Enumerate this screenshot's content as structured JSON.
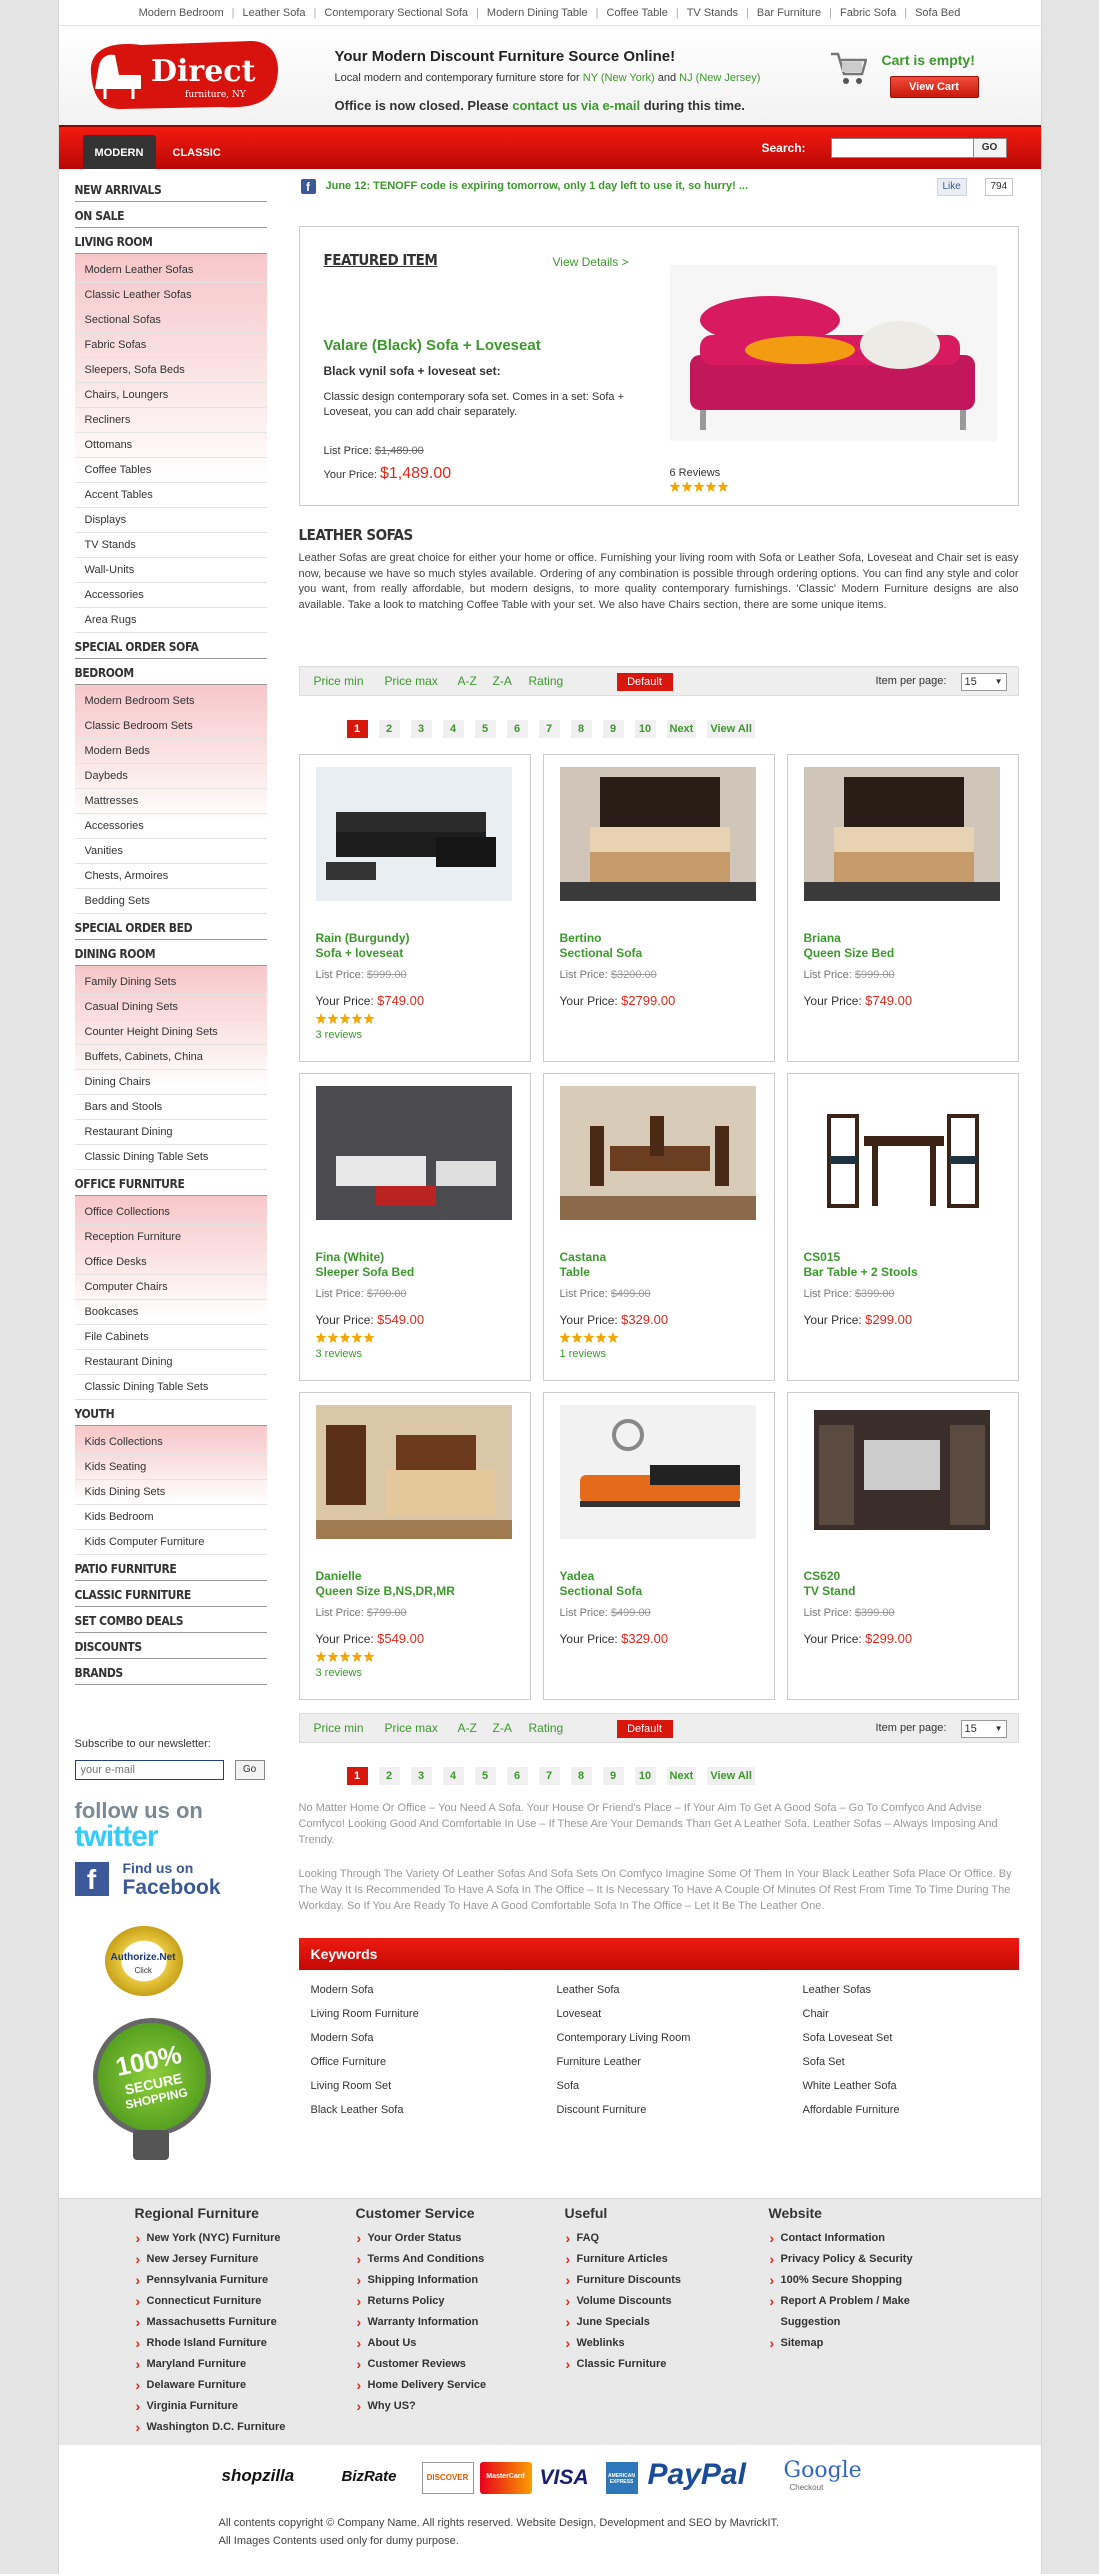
{
  "top_links": [
    "Modern Bedroom",
    "Leather Sofa",
    "Contemporary Sectional Sofa",
    "Modern Dining Table",
    "Coffee Table",
    "TV Stands",
    "Bar Furniture",
    "Fabric Sofa",
    "Sofa Bed"
  ],
  "header": {
    "logo_main": "Direct",
    "logo_sub": "furniture, NY",
    "title": "Your Modern Discount Furniture Source Online!",
    "sub_pre": "Local modern and contemporary furniture store for ",
    "sub_ny": "NY (New York)",
    "sub_and": " and ",
    "sub_nj": "NJ (New Jersey)",
    "closed_pre": "Office is now closed. Please ",
    "closed_link": "contact us via e-mail",
    "closed_post": " during this time.",
    "cart_empty": "Cart is empty!",
    "view_cart": "View Cart"
  },
  "nav": {
    "tab_modern": "MODERN",
    "tab_classic": "CLASSIC",
    "search_label": "Search:",
    "go": "GO"
  },
  "sidebar": [
    {
      "cat": "New Arrivals"
    },
    {
      "cat": "On Sale"
    },
    {
      "cat": "Living Room",
      "items": [
        "Modern Leather Sofas",
        "Classic Leather Sofas",
        "Sectional Sofas",
        "Fabric Sofas",
        "Sleepers, Sofa Beds",
        "Chairs, Loungers",
        "Recliners",
        "Ottomans",
        "Coffee Tables",
        "Accent Tables",
        "Displays",
        "TV Stands",
        "Wall-Units",
        "Accessories",
        "Area Rugs"
      ]
    },
    {
      "cat": "Special Order Sofa"
    },
    {
      "cat": "Bedroom",
      "items": [
        "Modern Bedroom Sets",
        "Classic Bedroom Sets",
        "Modern Beds",
        "Daybeds",
        "Mattresses",
        "Accessories",
        "Vanities",
        "Chests, Armoires",
        "Bedding Sets"
      ]
    },
    {
      "cat": "Special Order Bed"
    },
    {
      "cat": "Dining Room",
      "items": [
        "Family Dining Sets",
        "Casual Dining Sets",
        "Counter Height Dining Sets",
        "Buffets, Cabinets, China",
        "Dining Chairs",
        "Bars and Stools",
        "Restaurant Dining",
        "Classic Dining Table Sets"
      ]
    },
    {
      "cat": "Office Furniture",
      "items": [
        "Office Collections",
        "Reception Furniture",
        "Office Desks",
        "Computer Chairs",
        "Bookcases",
        "File Cabinets",
        "Restaurant Dining",
        "Classic Dining Table Sets"
      ]
    },
    {
      "cat": "Youth",
      "items": [
        "Kids Collections",
        "Kids Seating",
        "Kids Dining Sets",
        "Kids Bedroom",
        "Kids Computer Furniture"
      ]
    },
    {
      "cat": "Patio Furniture"
    },
    {
      "cat": "Classic Furniture"
    },
    {
      "cat": "Set Combo Deals"
    },
    {
      "cat": "Discounts"
    },
    {
      "cat": "Brands"
    }
  ],
  "newsletter": {
    "label": "Subscribe to our newsletter:",
    "placeholder": "your e-mail",
    "go": "Go"
  },
  "badges": {
    "twitter_1": "follow us on",
    "twitter_2": "twitter",
    "fb_1": "Find us on",
    "fb_2": "Facebook",
    "authorize": "Authorize.Net",
    "authorize_click": "Click",
    "secure_1": "100%",
    "secure_2": "SECURE",
    "secure_3": "SHOPPING"
  },
  "promo": {
    "text": "June 12: TENOFF code is expiring tomorrow, only 1 day left to use it, so hurry! ...",
    "like": "Like",
    "like_count": "794"
  },
  "featured": {
    "title": "FEATURED ITEM",
    "details": "View Details >",
    "name": "Valare (Black) Sofa + Loveseat",
    "subtitle": "Black vynil sofa + loveseat set:",
    "desc": "Classic design contemporary sofa set. Comes in a set: Sofa + Loveseat, you can add chair separately.",
    "list_label": "List Price:",
    "list_price": "$1,489.00",
    "your_label": "Your Price:",
    "your_price": "$1,489.00",
    "reviews": "6 Reviews",
    "rating": 5
  },
  "section": {
    "title": "LEATHER SOFAS",
    "desc": "Leather Sofas are great choice for either your home or office. Furnishing your living room with Sofa or Leather Sofa, Loveseat and Chair set is easy now, because we have so much styles available. Ordering of any combination is possible through ordering options. You can find any style and color you want, from really affordable, but modern designs, to more quality contemporary furnishings. 'Classic' Modern Furniture designs are also available. Take a look to matching Coffee Table with your set. We also have Chairs section, there are some unique items."
  },
  "sort": {
    "options": [
      "Price min",
      "Price max",
      "A-Z",
      "Z-A",
      "Rating"
    ],
    "default": "Default",
    "ipp_label": "Item per page:",
    "ipp_value": "15"
  },
  "pager": [
    "1",
    "2",
    "3",
    "4",
    "5",
    "6",
    "7",
    "8",
    "9",
    "10",
    "Next",
    "View All"
  ],
  "products": [
    {
      "n1": "Rain (Burgundy)",
      "n2": "Sofa + loveseat",
      "list": "$999.00",
      "price": "$749.00",
      "reviews": "3 reviews",
      "rating": 5,
      "img": "sofa-black"
    },
    {
      "n1": "Bertino",
      "n2": "Sectional Sofa",
      "list": "$3200.00",
      "price": "$2799.00",
      "img": "bed"
    },
    {
      "n1": "Briana",
      "n2": "Queen Size Bed",
      "list": "$999.00",
      "price": "$749.00",
      "img": "bed"
    },
    {
      "n1": "Fina (White)",
      "n2": "Sleeper Sofa Bed",
      "list": "$700.00",
      "price": "$549.00",
      "reviews": "3 reviews",
      "rating": 5,
      "img": "sofa-white"
    },
    {
      "n1": "Castana",
      "n2": "Table",
      "list": "$499.00",
      "price": "$329.00",
      "reviews": "1 reviews",
      "rating": 5,
      "img": "dining"
    },
    {
      "n1": "CS015",
      "n2": "Bar Table + 2 Stools",
      "list": "$399.00",
      "price": "$299.00",
      "img": "bartable"
    },
    {
      "n1": "Danielle",
      "n2": "Queen Size B,NS,DR,MR",
      "list": "$799.00",
      "price": "$549.00",
      "reviews": "3 reviews",
      "rating": 5,
      "img": "classicbed"
    },
    {
      "n1": "Yadea",
      "n2": "Sectional Sofa",
      "list": "$499.00",
      "price": "$329.00",
      "img": "orange-sofa"
    },
    {
      "n1": "CS620",
      "n2": "TV Stand",
      "list": "$399.00",
      "price": "$299.00",
      "img": "tvstand"
    }
  ],
  "product_labels": {
    "list": "List Price:",
    "your": "Your Price:"
  },
  "seo": [
    "No Matter Home Or Office – You Need A Sofa. Your House Or Friend's Place – If Your Aim To Get A Good Sofa – Go To Comfyco And Advise Comfyco! Looking Good And Comfortable In Use – If These Are Your Demands Than Get A Leather Sofa. Leather Sofas – Always Imposing And Trendy.",
    "Looking Through The Variety Of Leather Sofas And Sofa Sets On Comfyco Imagine Some Of Them In Your Black Leather Sofa Place Or Office. By The Way It Is Recommended To Have A Sofa In The Office – It Is Necessary To Have A Couple Of Minutes Of Rest From Time To Time During The Workday. So If You Are Ready To Have A Good Comfortable Sofa In The Office – Let It Be The Leather One."
  ],
  "keywords": {
    "title": "Keywords",
    "cols": [
      [
        "Modern Sofa",
        "Living Room Furniture",
        "Modern Sofa",
        "Office Furniture",
        "Living Room Set",
        "Black Leather Sofa"
      ],
      [
        "Leather Sofa",
        "Loveseat",
        "Contemporary Living Room",
        "Furniture Leather",
        "Sofa",
        "Discount Furniture"
      ],
      [
        "Leather Sofas",
        "Chair",
        "Sofa Loveseat Set",
        "Sofa Set",
        "White Leather Sofa",
        "Affordable Furniture"
      ]
    ]
  },
  "footer": [
    {
      "title": "Regional Furniture",
      "items": [
        "New York (NYC) Furniture",
        "New Jersey Furniture",
        "Pennsylvania Furniture",
        "Connecticut Furniture",
        "Massachusetts Furniture",
        "Rhode Island Furniture",
        "Maryland Furniture",
        "Delaware Furniture",
        "Virginia Furniture",
        "Washington D.C. Furniture"
      ]
    },
    {
      "title": "Customer Service",
      "items": [
        "Your Order Status",
        "Terms And Conditions",
        "Shipping Information",
        "Returns Policy",
        "Warranty Information",
        "About Us",
        "Customer Reviews",
        "Home Delivery Service",
        "Why US?"
      ]
    },
    {
      "title": "Useful",
      "items": [
        "FAQ",
        "Furniture Articles",
        "Furniture Discounts",
        "Volume Discounts",
        "June Specials",
        "Weblinks",
        "Classic Furniture"
      ]
    },
    {
      "title": "Website",
      "items": [
        "Contact Information",
        "Privacy Policy & Security",
        "100% Secure Shopping",
        "Report A Problem / Make Suggestion",
        "Sitemap"
      ]
    }
  ],
  "payment": {
    "shopzilla": "shopzilla",
    "bizrate": "BizRate",
    "discover": "DISCOVER",
    "mastercard": "MasterCard",
    "visa": "VISA",
    "amex": "AMERICAN EXPRESS",
    "paypal": "PayPal",
    "google": "Google",
    "google_sub": "Checkout"
  },
  "copyright": [
    "All contents copyright © Company Name. All rights reserved. Website Design, Development and SEO by MavrickIT.",
    "All Images Contents used only for dumy purpose."
  ]
}
